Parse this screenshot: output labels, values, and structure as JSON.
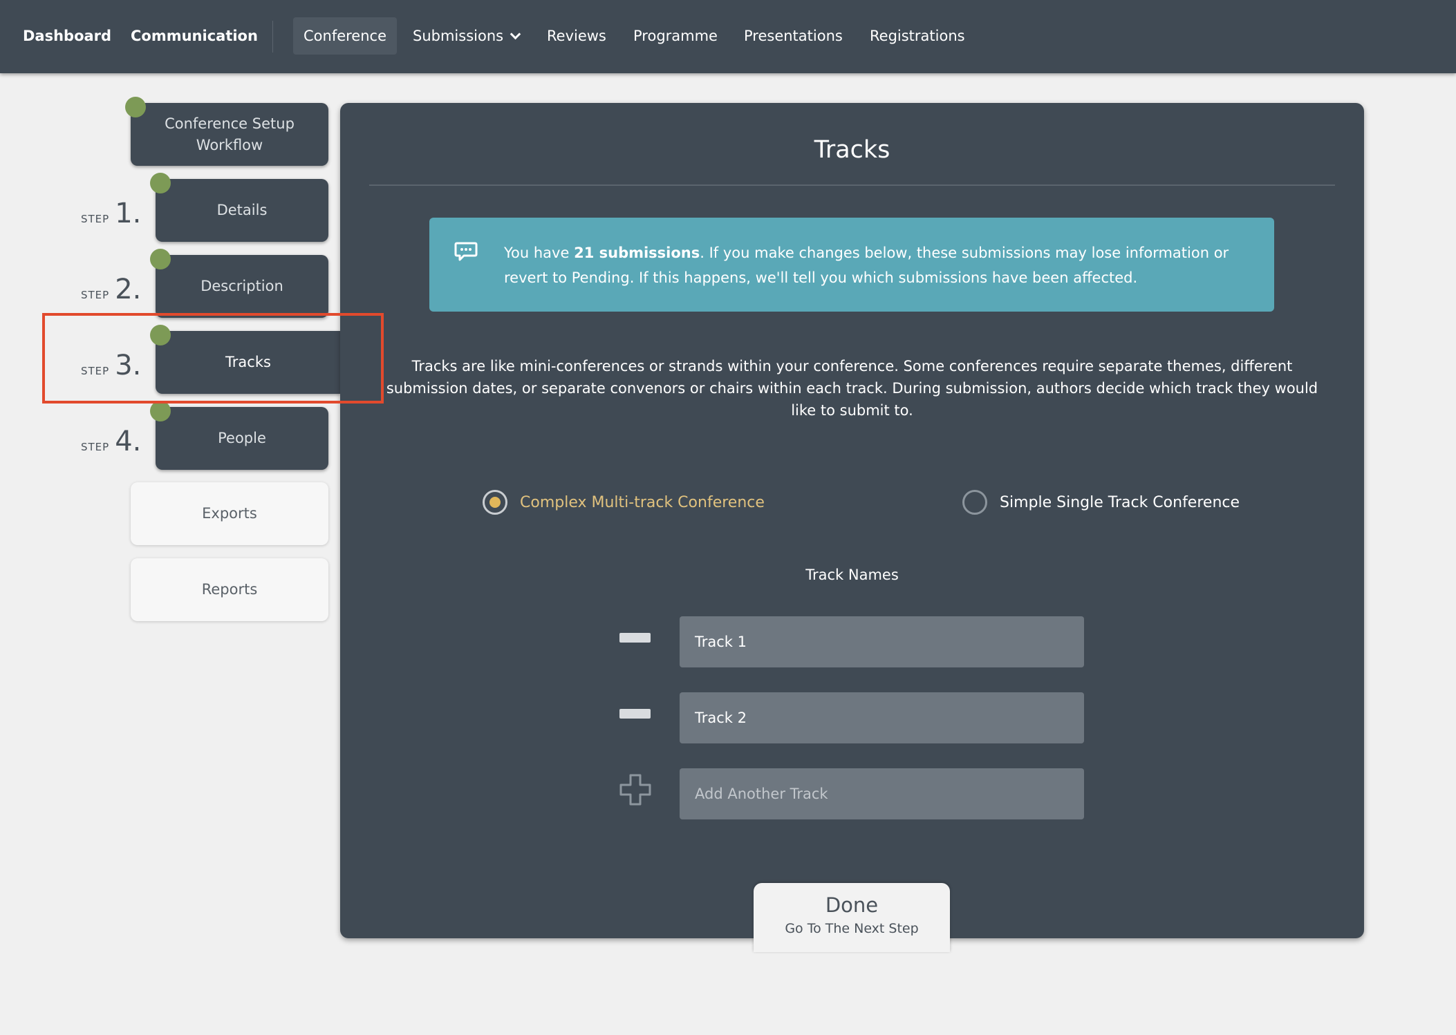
{
  "nav": {
    "dashboard": "Dashboard",
    "communication": "Communication",
    "conference": "Conference",
    "submissions": "Submissions",
    "reviews": "Reviews",
    "programme": "Programme",
    "presentations": "Presentations",
    "registrations": "Registrations"
  },
  "sidebar": {
    "workflow": "Conference Setup Workflow",
    "step_word": "STEP",
    "steps": [
      {
        "num": "1.",
        "label": "Details"
      },
      {
        "num": "2.",
        "label": "Description"
      },
      {
        "num": "3.",
        "label": "Tracks"
      },
      {
        "num": "4.",
        "label": "People"
      }
    ],
    "exports": "Exports",
    "reports": "Reports"
  },
  "main": {
    "title": "Tracks",
    "alert": {
      "prefix": "You have ",
      "bold": "21 submissions",
      "suffix": ". If you make changes below, these submissions may lose information or revert to Pending. If this happens, we'll tell you which submissions have been affected."
    },
    "description": "Tracks are like mini-conferences or strands within your conference. Some conferences require separate themes, different submission dates, or separate convenors or chairs within each track. During submission, authors decide which track they would like to submit to.",
    "options": {
      "complex": "Complex Multi-track Conference",
      "simple": "Simple Single Track Conference",
      "selected": "complex"
    },
    "track_names_label": "Track Names",
    "tracks": [
      "Track 1",
      "Track 2"
    ],
    "add_placeholder": "Add Another Track",
    "done": {
      "label": "Done",
      "sub": "Go To The Next Step"
    }
  },
  "colors": {
    "nav_bg": "#404a54",
    "alert_bg": "#5aa8b7",
    "step_dot": "#7d9a56",
    "selected_radio": "#e1b75a",
    "highlight": "#e24a2d"
  }
}
